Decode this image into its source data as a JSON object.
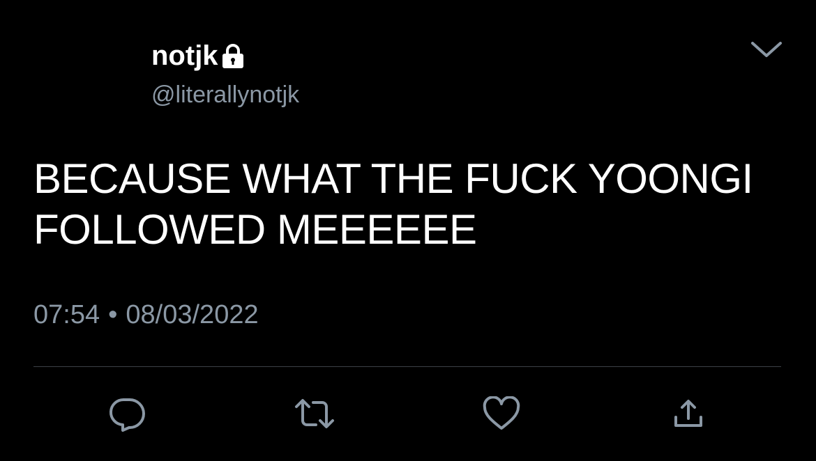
{
  "tweet": {
    "display_name": "notjk",
    "handle": "@literallynotjk",
    "text_line1": "BECAUSE WHAT THE FUCK YOONGI",
    "text_line2": "FOLLOWED MEEEEEE",
    "time": "07:54",
    "separator": "•",
    "date": "08/03/2022",
    "protected_icon": "lock-icon",
    "more_icon": "chevron-down-icon"
  },
  "actions": [
    {
      "name": "reply",
      "icon": "reply-icon"
    },
    {
      "name": "retweet",
      "icon": "retweet-icon"
    },
    {
      "name": "like",
      "icon": "heart-icon"
    },
    {
      "name": "share",
      "icon": "share-icon"
    }
  ],
  "colors": {
    "background": "#000000",
    "primary_text": "#ffffff",
    "secondary_text": "#8b98a5",
    "divider": "#3d4147"
  }
}
